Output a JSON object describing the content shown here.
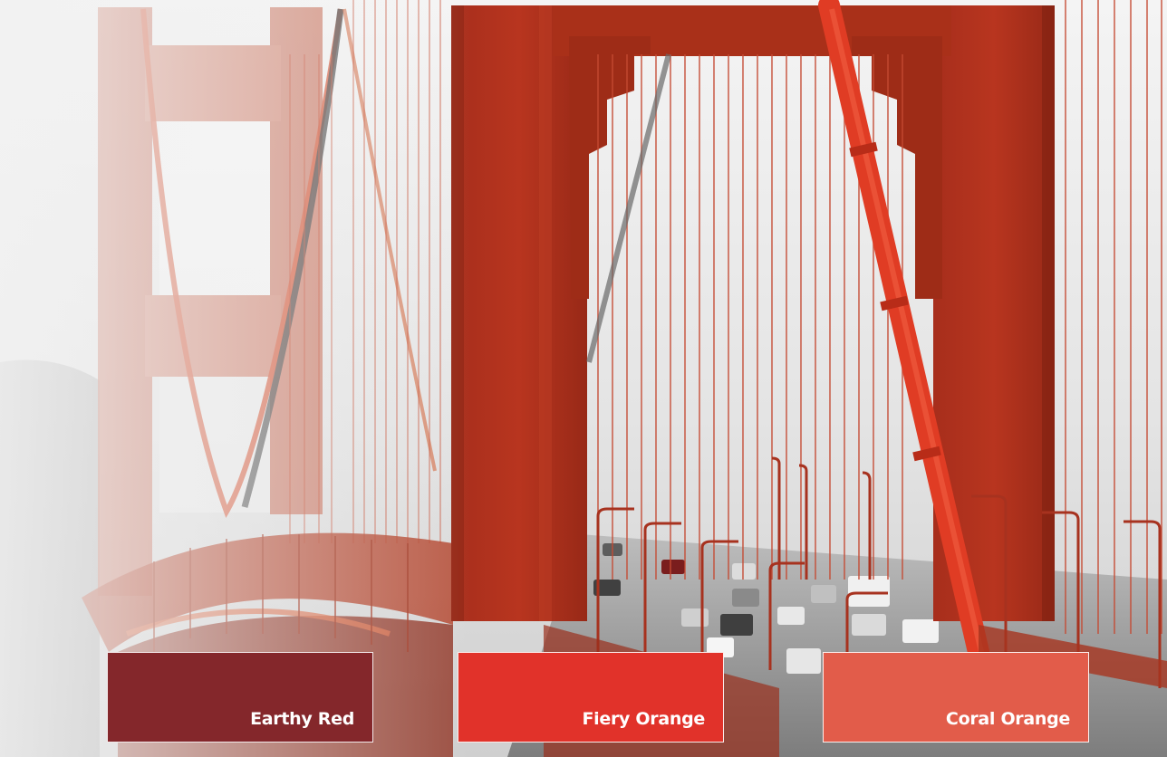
{
  "palette": {
    "swatches": [
      {
        "label": "Earthy Red",
        "color": "#84272b"
      },
      {
        "label": "Fiery Orange",
        "color": "#e1322a"
      },
      {
        "label": "Coral Orange",
        "color": "#e25c4a"
      }
    ]
  },
  "photo": {
    "colors": {
      "tower": "#b2321f",
      "tower_dark": "#8c2517",
      "cable": "#e23a24",
      "fog": "#f2f2f2"
    }
  }
}
